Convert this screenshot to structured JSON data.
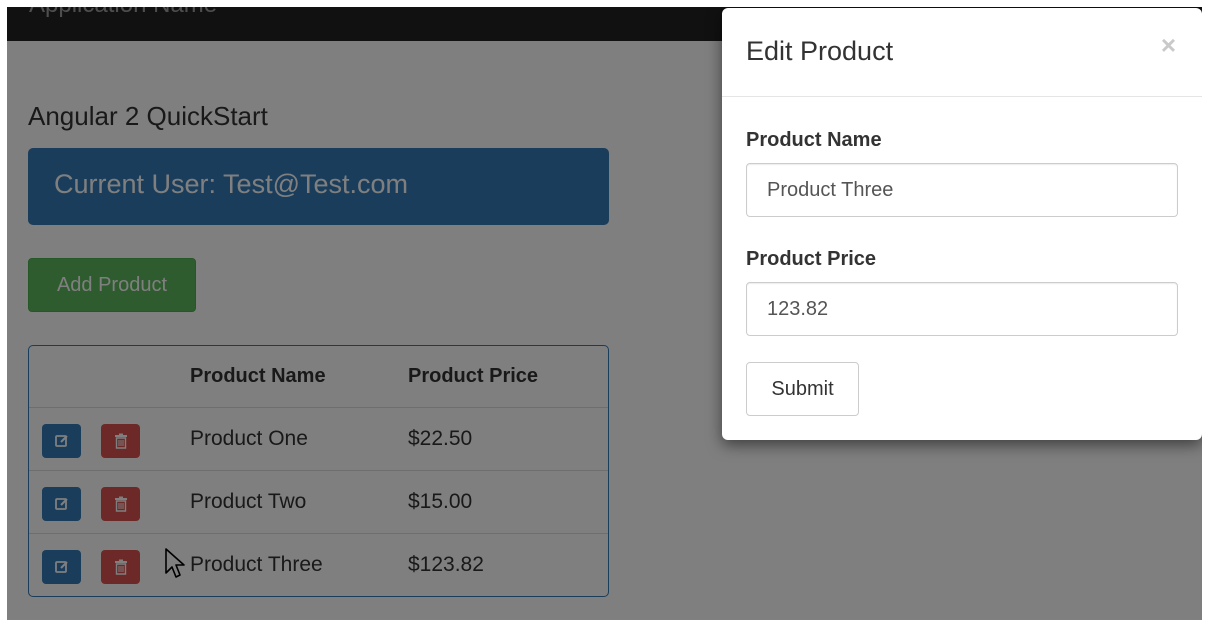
{
  "app": {
    "brand": "Application Name",
    "page_title": "Angular 2 QuickStart",
    "current_user": "Current User: Test@Test.com",
    "add_product_label": "Add Product"
  },
  "table": {
    "columns": [
      "",
      "Product Name",
      "Product Price"
    ],
    "rows": [
      {
        "name": "Product One",
        "price": "$22.50"
      },
      {
        "name": "Product Two",
        "price": "$15.00"
      },
      {
        "name": "Product Three",
        "price": "$123.82"
      }
    ],
    "row_actions": {
      "edit_icon": "edit-icon",
      "delete_icon": "trash-icon"
    }
  },
  "modal": {
    "title": "Edit Product",
    "close_symbol": "×",
    "fields": {
      "name_label": "Product Name",
      "name_value": "Product Three",
      "price_label": "Product Price",
      "price_value": "123.82"
    },
    "submit_label": "Submit"
  },
  "colors": {
    "primary": "#337ab7",
    "success": "#5cb85c",
    "danger": "#d9534f",
    "navbar": "#222222",
    "backdrop": "rgba(0,0,0,0.5)"
  }
}
